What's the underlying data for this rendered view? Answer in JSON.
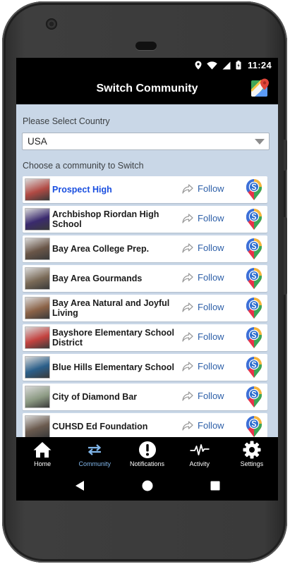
{
  "status_bar": {
    "time": "11:24"
  },
  "header": {
    "title": "Switch Community"
  },
  "country_select": {
    "label": "Please Select Country",
    "value": "USA"
  },
  "community_list": {
    "label": "Choose a community to Switch",
    "items": [
      {
        "name": "Prospect High",
        "follow_label": "Follow",
        "thumb_color": "#b14a44",
        "active": true
      },
      {
        "name": "Archbishop Riordan High School",
        "follow_label": "Follow",
        "thumb_color": "#3a2a6e",
        "active": false
      },
      {
        "name": "Bay Area College Prep.",
        "follow_label": "Follow",
        "thumb_color": "#6a5648",
        "active": false
      },
      {
        "name": "Bay Area Gourmands",
        "follow_label": "Follow",
        "thumb_color": "#7a6a57",
        "active": false
      },
      {
        "name": "Bay Area Natural and Joyful Living",
        "follow_label": "Follow",
        "thumb_color": "#8b6247",
        "active": false
      },
      {
        "name": "Bayshore Elementary School District",
        "follow_label": "Follow",
        "thumb_color": "#c3423f",
        "active": false
      },
      {
        "name": "Blue Hills Elementary School",
        "follow_label": "Follow",
        "thumb_color": "#2b5f8a",
        "active": false
      },
      {
        "name": "City of Diamond Bar",
        "follow_label": "Follow",
        "thumb_color": "#8c9a83",
        "active": false
      },
      {
        "name": "CUHSD Ed Foundation",
        "follow_label": "Follow",
        "thumb_color": "#6b5b4f",
        "active": false
      }
    ]
  },
  "tab_bar": {
    "tabs": [
      {
        "label": "Home",
        "icon": "home-icon",
        "active": false
      },
      {
        "label": "Community",
        "icon": "swap-arrows-icon",
        "active": true
      },
      {
        "label": "Notifications",
        "icon": "alert-icon",
        "active": false
      },
      {
        "label": "Activity",
        "icon": "pulse-icon",
        "active": false
      },
      {
        "label": "Settings",
        "icon": "gear-icon",
        "active": false
      }
    ]
  },
  "colors": {
    "accent": "#1a4fe0",
    "follow": "#2d5fa8",
    "content_bg": "#c9d7e7",
    "active_tab": "#80b6ea"
  }
}
